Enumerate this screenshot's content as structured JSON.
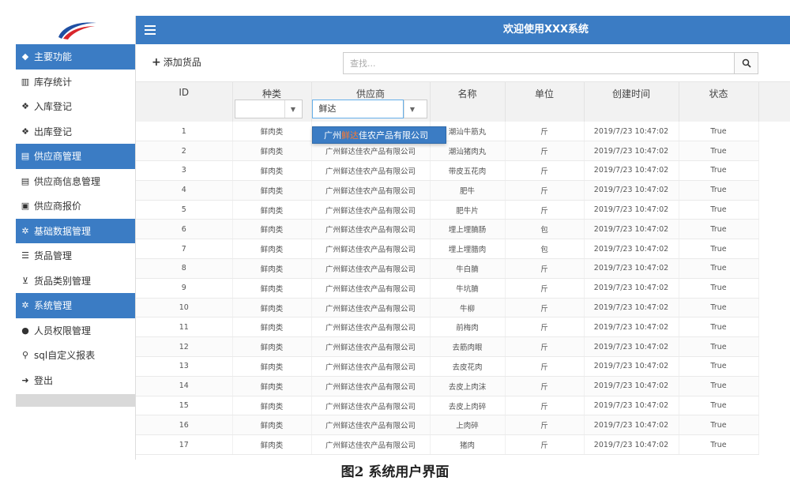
{
  "sidebar": {
    "items": [
      {
        "label": "主要功能",
        "icon": "tag-icon",
        "glyph": "◆",
        "group": true
      },
      {
        "label": "库存统计",
        "icon": "bar-chart-icon",
        "glyph": "▥",
        "group": false
      },
      {
        "label": "入库登记",
        "icon": "cubes-icon",
        "glyph": "❖",
        "group": false
      },
      {
        "label": "出库登记",
        "icon": "cubes-icon",
        "glyph": "❖",
        "group": false
      },
      {
        "label": "供应商管理",
        "icon": "file-icon",
        "glyph": "▤",
        "group": true
      },
      {
        "label": "供应商信息管理",
        "icon": "file-icon",
        "glyph": "▤",
        "group": false
      },
      {
        "label": "供应商报价",
        "icon": "id-card-icon",
        "glyph": "▣",
        "group": false
      },
      {
        "label": "基础数据管理",
        "icon": "gears-icon",
        "glyph": "✲",
        "group": true
      },
      {
        "label": "货品管理",
        "icon": "list-icon",
        "glyph": "☰",
        "group": false
      },
      {
        "label": "货品类别管理",
        "icon": "cart-icon",
        "glyph": "⊻",
        "group": false
      },
      {
        "label": "系统管理",
        "icon": "gears-icon",
        "glyph": "✲",
        "group": true
      },
      {
        "label": "人员权限管理",
        "icon": "user-icon",
        "glyph": "●",
        "group": false
      },
      {
        "label": "sql自定义报表",
        "icon": "search-icon",
        "glyph": "⚲",
        "group": false
      },
      {
        "label": "登出",
        "icon": "sign-out-icon",
        "glyph": "➜",
        "group": false
      }
    ]
  },
  "header": {
    "title": "欢迎使用XXX系统"
  },
  "toolbar": {
    "add_label": "添加货品",
    "search_placeholder": "查找..."
  },
  "table": {
    "columns": [
      "ID",
      "种类",
      "供应商",
      "名称",
      "单位",
      "创建时间",
      "状态"
    ],
    "kind_filter": "",
    "supplier_filter": "鲜达",
    "rows": [
      [
        "1",
        "鲜肉类",
        "广州鲜达佳农产品有限公司",
        "潮汕牛筋丸",
        "斤",
        "2019/7/23 10:47:02",
        "True"
      ],
      [
        "2",
        "鲜肉类",
        "广州鲜达佳农产品有限公司",
        "潮汕猪肉丸",
        "斤",
        "2019/7/23 10:47:02",
        "True"
      ],
      [
        "3",
        "鲜肉类",
        "广州鲜达佳农产品有限公司",
        "带皮五花肉",
        "斤",
        "2019/7/23 10:47:02",
        "True"
      ],
      [
        "4",
        "鲜肉类",
        "广州鲜达佳农产品有限公司",
        "肥牛",
        "斤",
        "2019/7/23 10:47:02",
        "True"
      ],
      [
        "5",
        "鲜肉类",
        "广州鲜达佳农产品有限公司",
        "肥牛片",
        "斤",
        "2019/7/23 10:47:02",
        "True"
      ],
      [
        "6",
        "鲜肉类",
        "广州鲜达佳农产品有限公司",
        "埋上埋腩肠",
        "包",
        "2019/7/23 10:47:02",
        "True"
      ],
      [
        "7",
        "鲜肉类",
        "广州鲜达佳农产品有限公司",
        "埋上埋腊肉",
        "包",
        "2019/7/23 10:47:02",
        "True"
      ],
      [
        "8",
        "鲜肉类",
        "广州鲜达佳农产品有限公司",
        "牛白腩",
        "斤",
        "2019/7/23 10:47:02",
        "True"
      ],
      [
        "9",
        "鲜肉类",
        "广州鲜达佳农产品有限公司",
        "牛坑腩",
        "斤",
        "2019/7/23 10:47:02",
        "True"
      ],
      [
        "10",
        "鲜肉类",
        "广州鲜达佳农产品有限公司",
        "牛柳",
        "斤",
        "2019/7/23 10:47:02",
        "True"
      ],
      [
        "11",
        "鲜肉类",
        "广州鲜达佳农产品有限公司",
        "前梅肉",
        "斤",
        "2019/7/23 10:47:02",
        "True"
      ],
      [
        "12",
        "鲜肉类",
        "广州鲜达佳农产品有限公司",
        "去筋肉眼",
        "斤",
        "2019/7/23 10:47:02",
        "True"
      ],
      [
        "13",
        "鲜肉类",
        "广州鲜达佳农产品有限公司",
        "去皮花肉",
        "斤",
        "2019/7/23 10:47:02",
        "True"
      ],
      [
        "14",
        "鲜肉类",
        "广州鲜达佳农产品有限公司",
        "去皮上肉沫",
        "斤",
        "2019/7/23 10:47:02",
        "True"
      ],
      [
        "15",
        "鲜肉类",
        "广州鲜达佳农产品有限公司",
        "去皮上肉碎",
        "斤",
        "2019/7/23 10:47:02",
        "True"
      ],
      [
        "16",
        "鲜肉类",
        "广州鲜达佳农产品有限公司",
        "上肉碎",
        "斤",
        "2019/7/23 10:47:02",
        "True"
      ],
      [
        "17",
        "鲜肉类",
        "广州鲜达佳农产品有限公司",
        "猪肉",
        "斤",
        "2019/7/23 10:47:02",
        "True"
      ]
    ]
  },
  "suggestion": {
    "prefix": "广州",
    "match": "鲜达",
    "suffix": "佳农产品有限公司"
  },
  "caption": "图2  系统用户界面",
  "colors": {
    "primary": "#3b7cc4",
    "highlight": "#ff7a2e",
    "header_bg": "#f2f2f2"
  }
}
